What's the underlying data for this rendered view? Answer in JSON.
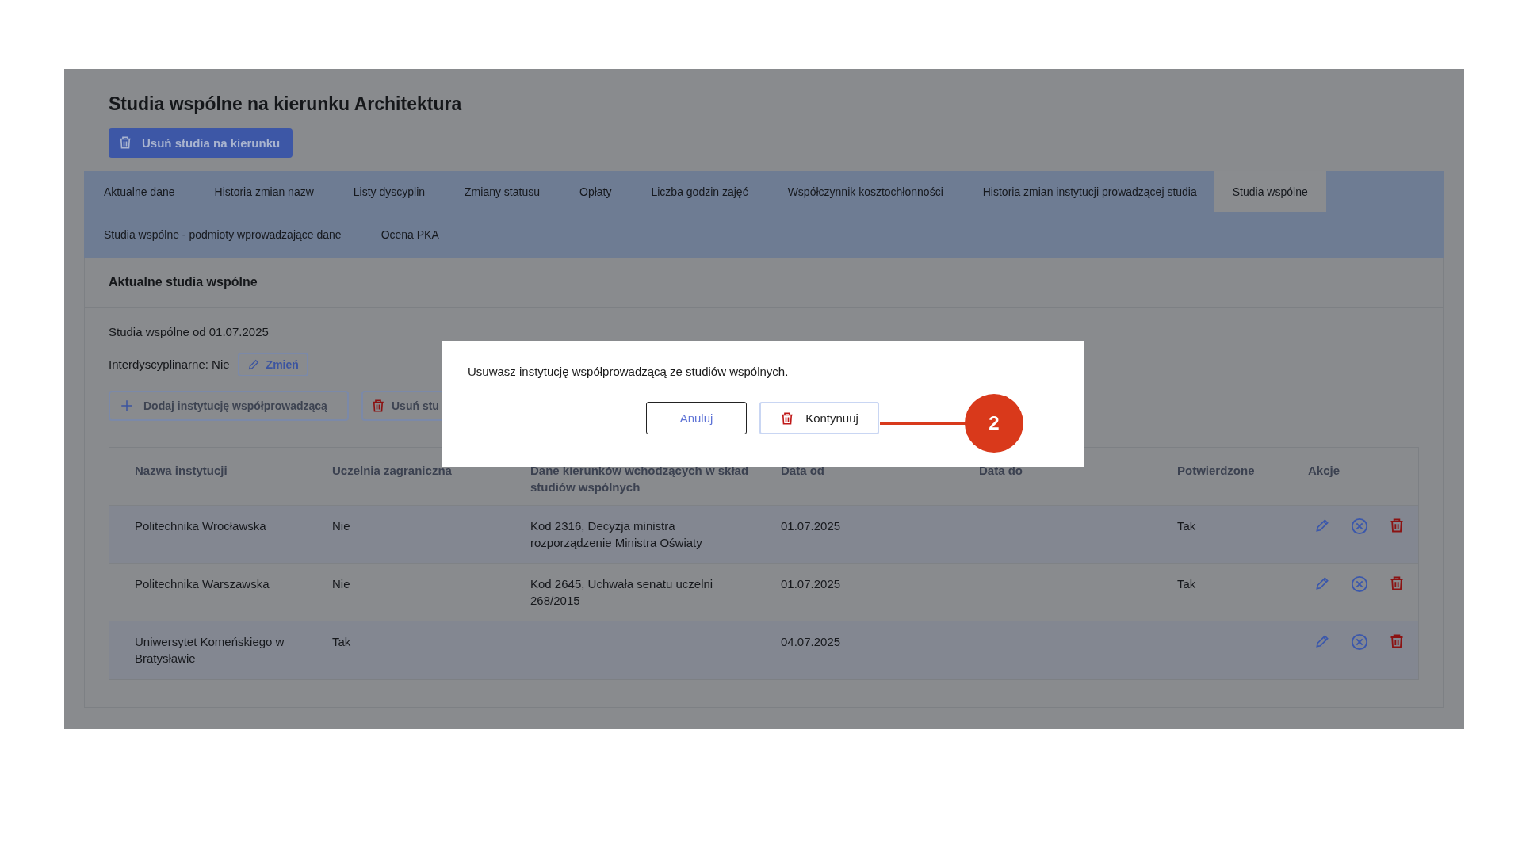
{
  "page": {
    "title": "Studia wspólne na kierunku Architektura",
    "delete_button": "Usuń studia na kierunku",
    "tabs": [
      {
        "label": "Aktualne dane",
        "selected": false
      },
      {
        "label": "Historia zmian nazw",
        "selected": false
      },
      {
        "label": "Listy dyscyplin",
        "selected": false
      },
      {
        "label": "Zmiany statusu",
        "selected": false
      },
      {
        "label": "Opłaty",
        "selected": false
      },
      {
        "label": "Liczba godzin zajęć",
        "selected": false
      },
      {
        "label": "Współczynnik kosztochłonności",
        "selected": false
      },
      {
        "label": "Historia zmian instytucji prowadzącej studia",
        "selected": false
      },
      {
        "label": "Studia wspólne",
        "selected": true
      },
      {
        "label": "Studia wspólne - podmioty wprowadzające dane",
        "selected": false
      },
      {
        "label": "Ocena PKA",
        "selected": false
      }
    ],
    "section": {
      "title": "Aktualne studia wspólne",
      "since": "Studia wspólne od 01.07.2025",
      "interdisciplinary": "Interdyscyplinarne: Nie",
      "change_button": "Zmień",
      "add_button": "Dodaj instytucję współprowadzącą",
      "remove_button": "Usuń stu"
    },
    "table": {
      "columns": [
        "Nazwa instytucji",
        "Uczelnia zagraniczna",
        "Dane kierunków wchodzących w skład studiów wspólnych",
        "Data od",
        "Data do",
        "Potwierdzone",
        "Akcje"
      ],
      "rows": [
        {
          "name": "Politechnika Wrocławska",
          "foreign": "Nie",
          "programs": "Kod 2316, Decyzja ministra rozporządzenie Ministra Oświaty",
          "date_from": "01.07.2025",
          "confirmed": "Tak"
        },
        {
          "name": "Politechnika Warszawska",
          "foreign": "Nie",
          "programs": "Kod 2645, Uchwała senatu uczelni 268/2015",
          "date_from": "01.07.2025",
          "confirmed": "Tak"
        },
        {
          "name": "Uniwersytet Komeńskiego w Bratysławie",
          "foreign": "Tak",
          "date_from": "04.07.2025"
        }
      ]
    }
  },
  "dialog": {
    "message": "Usuwasz instytucję współprowadzącą ze studiów wspólnych.",
    "buttons": [
      {
        "label": "Anuluj",
        "kind": "cancel"
      },
      {
        "label": "Kontynuuj",
        "kind": "confirm"
      }
    ]
  },
  "callout": {
    "label": "2"
  }
}
